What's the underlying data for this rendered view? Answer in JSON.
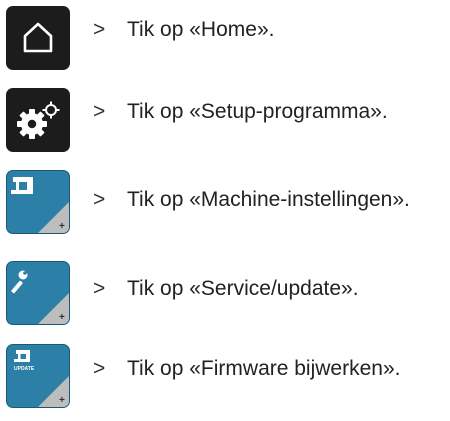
{
  "steps": [
    {
      "icon": "home-icon",
      "arrow": ">",
      "text": "Tik op «Home»."
    },
    {
      "icon": "setup-gears-icon",
      "arrow": ">",
      "text": "Tik op «Setup-programma»."
    },
    {
      "icon": "sewing-machine-settings-icon",
      "arrow": ">",
      "text": "Tik op «Machine-instellingen»."
    },
    {
      "icon": "wrench-service-icon",
      "arrow": ">",
      "text": "Tik op «Service/update»."
    },
    {
      "icon": "firmware-update-icon",
      "arrow": ">",
      "text": "Tik op «Firmware bijwerken»."
    }
  ],
  "update_icon_label": "UPDATE",
  "colors": {
    "dark_tile": "#1c1c1c",
    "blue_tile": "#2c7fa6",
    "corner_gray": "#bdbdbd"
  }
}
